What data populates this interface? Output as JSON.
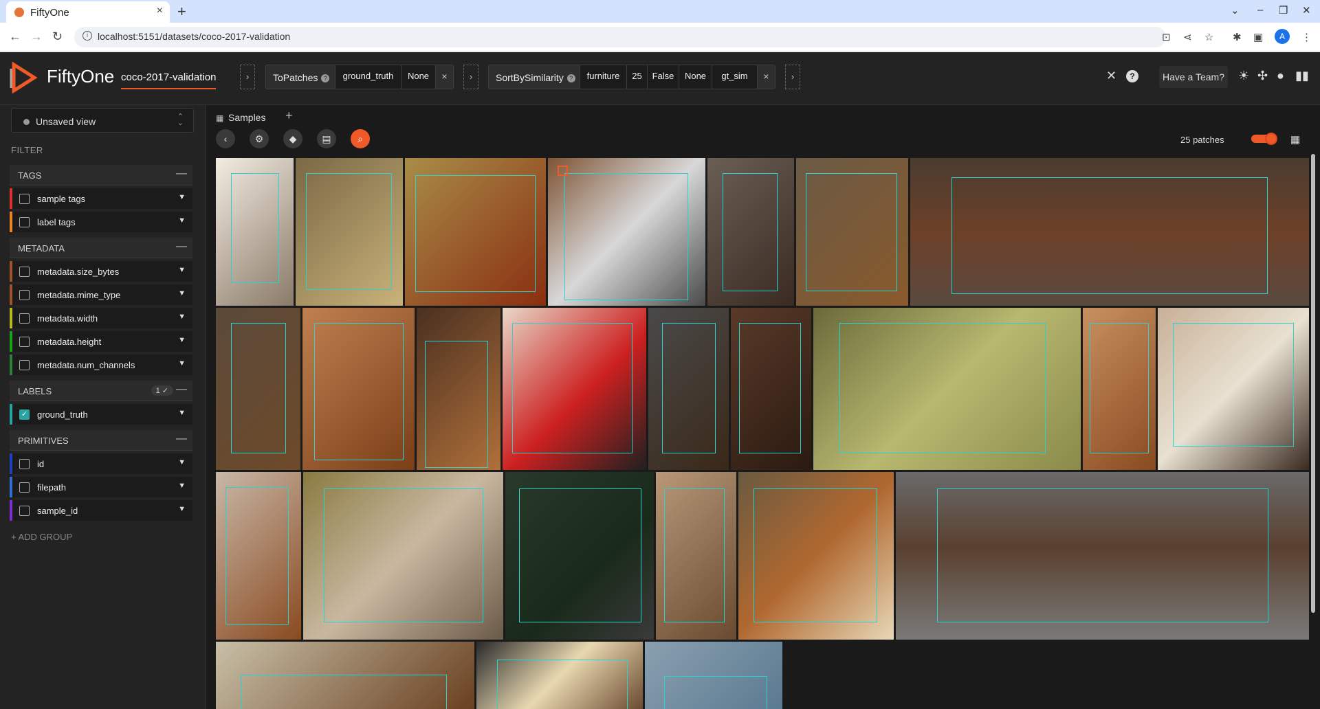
{
  "browser": {
    "tab_title": "FiftyOne",
    "tab_close": "×",
    "new_tab": "+",
    "url": "localhost:5151/datasets/coco-2017-validation",
    "profile_initial": "A",
    "controls": {
      "collapse": "⌄",
      "minimize": "–",
      "restore": "❐",
      "close": "✕"
    }
  },
  "app": {
    "brand": "FiftyOne",
    "dataset_name": "coco-2017-validation",
    "team_button": "Have a Team?",
    "stages": [
      {
        "name": "ToPatches",
        "params": [
          "ground_truth",
          "None"
        ]
      },
      {
        "name": "SortBySimilarity",
        "params": [
          "furniture",
          "25",
          "False",
          "None",
          "gt_sim"
        ]
      }
    ],
    "stage_help": "?",
    "stage_remove": "×",
    "stage_arrow": "›"
  },
  "sidebar": {
    "view_label": "Unsaved view",
    "filter_heading": "FILTER",
    "groups": [
      {
        "name": "TAGS",
        "fields": [
          {
            "name": "sample tags",
            "color": "#e02f2f",
            "checked": false
          },
          {
            "name": "label tags",
            "color": "#e8832a",
            "checked": false
          }
        ]
      },
      {
        "name": "METADATA",
        "fields": [
          {
            "name": "metadata.size_bytes",
            "color": "#a0522d",
            "checked": false
          },
          {
            "name": "metadata.mime_type",
            "color": "#a0522d",
            "checked": false
          },
          {
            "name": "metadata.width",
            "color": "#b8b820",
            "checked": false
          },
          {
            "name": "metadata.height",
            "color": "#1aa31a",
            "checked": false
          },
          {
            "name": "metadata.num_channels",
            "color": "#2f7f3a",
            "checked": false
          }
        ]
      },
      {
        "name": "LABELS",
        "count": "1 ✓",
        "fields": [
          {
            "name": "ground_truth",
            "color": "#2aa3a3",
            "checked": true
          }
        ]
      },
      {
        "name": "PRIMITIVES",
        "fields": [
          {
            "name": "id",
            "color": "#1f3fbf",
            "checked": false
          },
          {
            "name": "filepath",
            "color": "#2f6fcf",
            "checked": false
          },
          {
            "name": "sample_id",
            "color": "#7a2fcf",
            "checked": false
          }
        ]
      }
    ],
    "add_group": "+ ADD GROUP"
  },
  "main": {
    "tab_label": "Samples",
    "add_panel": "+",
    "patch_count": "25 patches"
  }
}
